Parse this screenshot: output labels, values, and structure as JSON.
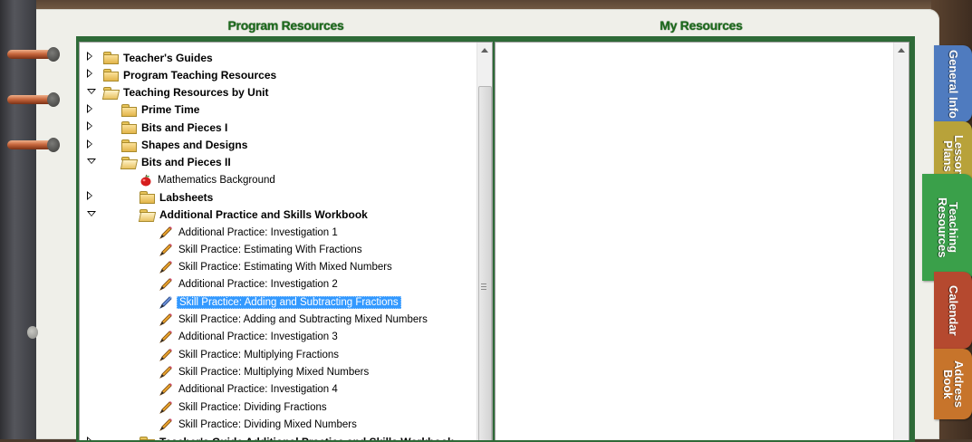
{
  "panels": {
    "left_title": "Program Resources",
    "right_title": "My Resources"
  },
  "tabs": [
    {
      "label": "General Info",
      "color": "#4f7bbf"
    },
    {
      "label": "Lesson Plans",
      "color": "#b8a23a"
    },
    {
      "label": "Teaching Resources",
      "color": "#3aa04a"
    },
    {
      "label": "Calendar",
      "color": "#b5492f"
    },
    {
      "label": "Address Book",
      "color": "#c7742b"
    }
  ],
  "tree": [
    {
      "label": "Teacher's Guides",
      "type": "folder",
      "state": "closed",
      "level": 0
    },
    {
      "label": "Program Teaching Resources",
      "type": "folder",
      "state": "closed",
      "level": 0
    },
    {
      "label": "Teaching Resources by Unit",
      "type": "folder",
      "state": "open",
      "level": 0
    },
    {
      "label": "Prime Time",
      "type": "folder",
      "state": "closed",
      "level": 1
    },
    {
      "label": "Bits and Pieces I",
      "type": "folder",
      "state": "closed",
      "level": 1
    },
    {
      "label": "Shapes and Designs",
      "type": "folder",
      "state": "closed",
      "level": 1
    },
    {
      "label": "Bits and Pieces II",
      "type": "folder",
      "state": "open",
      "level": 1
    },
    {
      "label": "Mathematics Background",
      "type": "apple",
      "level": 2
    },
    {
      "label": "Labsheets",
      "type": "folder",
      "state": "closed",
      "level": 2
    },
    {
      "label": "Additional Practice and Skills Workbook",
      "type": "folder",
      "state": "open",
      "level": 2
    },
    {
      "label": "Additional Practice: Investigation 1",
      "type": "pencil",
      "level": 3
    },
    {
      "label": "Skill Practice: Estimating With Fractions",
      "type": "pencil",
      "level": 3
    },
    {
      "label": "Skill Practice: Estimating With Mixed Numbers",
      "type": "pencil",
      "level": 3
    },
    {
      "label": "Additional Practice: Investigation 2",
      "type": "pencil",
      "level": 3
    },
    {
      "label": "Skill Practice: Adding and Subtracting Fractions",
      "type": "pencil",
      "level": 3,
      "selected": true
    },
    {
      "label": "Skill Practice: Adding and Subtracting Mixed Numbers",
      "type": "pencil",
      "level": 3
    },
    {
      "label": "Additional Practice: Investigation 3",
      "type": "pencil",
      "level": 3
    },
    {
      "label": "Skill Practice: Multiplying Fractions",
      "type": "pencil",
      "level": 3
    },
    {
      "label": "Skill Practice: Multiplying Mixed Numbers",
      "type": "pencil",
      "level": 3
    },
    {
      "label": "Additional Practice: Investigation 4",
      "type": "pencil",
      "level": 3
    },
    {
      "label": "Skill Practice: Dividing Fractions",
      "type": "pencil",
      "level": 3
    },
    {
      "label": "Skill Practice: Dividing Mixed Numbers",
      "type": "pencil",
      "level": 3
    },
    {
      "label": "Teacher's Guide Additional Practice and Skills Workbook",
      "type": "folder",
      "state": "closed",
      "level": 2
    }
  ]
}
